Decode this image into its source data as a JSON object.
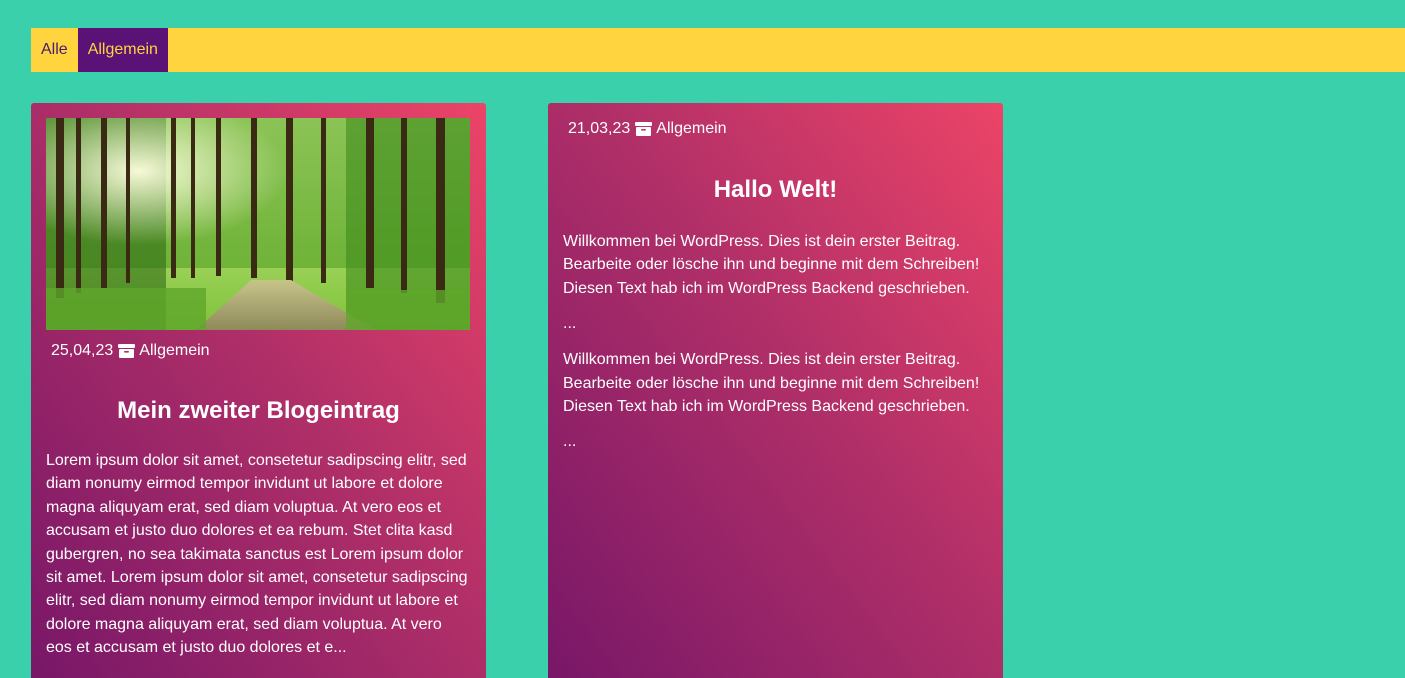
{
  "filters": {
    "all_label": "Alle",
    "category_label": "Allgemein"
  },
  "posts": [
    {
      "date": "25,04,23",
      "category": "Allgemein",
      "title": "Mein zweiter Blogeintrag",
      "text": "Lorem ipsum dolor sit amet, consetetur sadipscing elitr, sed diam nonumy eirmod tempor invidunt ut labore et dolore magna aliquyam erat, sed diam voluptua. At vero eos et accusam et justo duo dolores et ea rebum. Stet clita kasd gubergren, no sea takimata sanctus est Lorem ipsum dolor sit amet. Lorem ipsum dolor sit amet, consetetur sadipscing elitr, sed diam nonumy eirmod tempor invidunt ut labore et dolore magna aliquyam erat, sed diam voluptua. At vero eos et accusam et justo duo dolores et e..."
    },
    {
      "date": "21,03,23",
      "category": "Allgemein",
      "title": "Hallo Welt!",
      "excerpt_1": "Willkommen bei WordPress. Dies ist dein erster Beitrag. Bearbeite oder lösche ihn und beginne mit dem Schreiben! Diesen Text hab ich im WordPress Backend geschrieben.",
      "more_1": "...",
      "excerpt_2": "Willkommen bei WordPress. Dies ist dein erster Beitrag. Bearbeite oder lösche ihn und beginne mit dem Schreiben! Diesen Text hab ich im WordPress Backend geschrieben.",
      "more_2": "..."
    }
  ],
  "icons": {
    "category": "archive-icon"
  },
  "colors": {
    "background": "#3ad0ac",
    "filter_bar": "#ffd43f",
    "filter_active_bg": "#5a1276",
    "card_gradient_start": "#761668",
    "card_gradient_end": "#ec4467"
  }
}
